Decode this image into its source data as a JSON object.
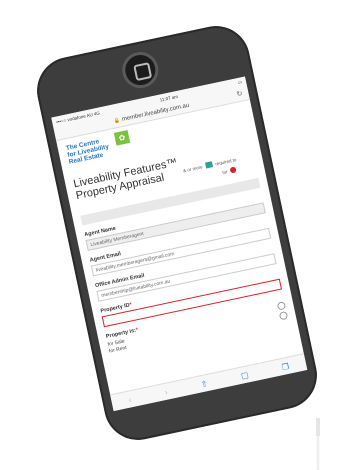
{
  "status": {
    "carrier": "•••○○ vodafone AU  4G",
    "time": "11:07 am"
  },
  "browser": {
    "url": "member.liveability.com.au",
    "lock_icon": "lock-icon",
    "reload_icon": "reload-icon"
  },
  "logo": {
    "line1": "The Centre",
    "line2": "for Liveability",
    "line3": "Real Estate"
  },
  "page": {
    "title": "Liveability Features™ Property Appraisal",
    "legend_or_more": "& or more",
    "legend_required": "required to",
    "legend_for": "for"
  },
  "form": {
    "agent_name_label": "Agent Name",
    "agent_name_value": "Liveability Memberagent",
    "agent_email_label": "Agent Email",
    "agent_email_value": "liveability.memberagent@gmail.com",
    "office_email_label": "Office Admin Email",
    "office_email_value": "membership@liveability.com.au",
    "property_id_label": "Property ID",
    "property_id_value": "",
    "property_is_label": "Property is:",
    "opt_sale": "for Sale",
    "opt_rent": "for Rent"
  },
  "toolbar": {
    "back": "‹",
    "forward": "›",
    "share": "⇧",
    "bookmarks": "▢",
    "tabs": "❐"
  },
  "colors": {
    "phone": "#3d3d3d",
    "logo_blue": "#2b77b8",
    "logo_green": "#7cc142",
    "error": "#d8202a",
    "teal": "#2aa198"
  }
}
